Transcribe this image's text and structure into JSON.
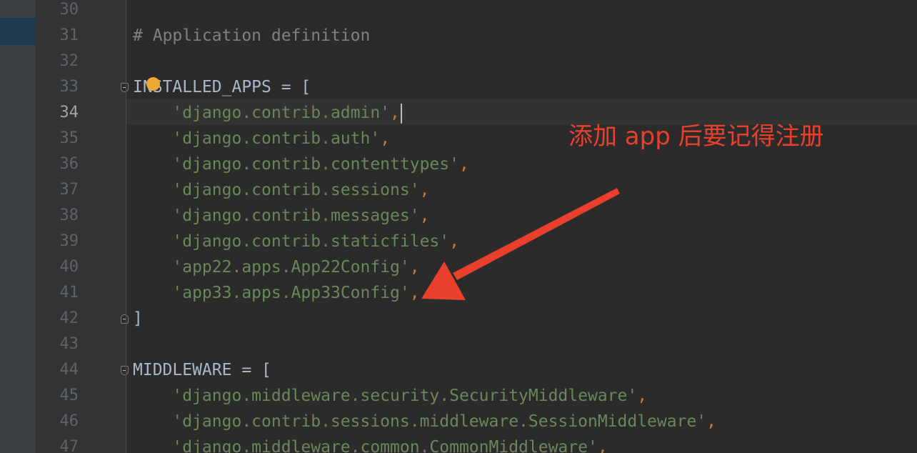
{
  "editor": {
    "lines": [
      {
        "num": "30",
        "tokens": []
      },
      {
        "num": "31",
        "tokens": [
          {
            "t": "# Application definition",
            "c": "comment"
          }
        ]
      },
      {
        "num": "32",
        "tokens": []
      },
      {
        "num": "33",
        "fold": "start",
        "tokens": [
          {
            "t": "INSTALLED_APPS = [",
            "c": "ident"
          }
        ]
      },
      {
        "num": "34",
        "active": true,
        "caret": true,
        "tokens": [
          {
            "t": "    ",
            "c": "ident"
          },
          {
            "t": "'django.contrib.admin'",
            "c": "str"
          },
          {
            "t": ",",
            "c": "punct"
          }
        ]
      },
      {
        "num": "35",
        "tokens": [
          {
            "t": "    ",
            "c": "ident"
          },
          {
            "t": "'django.contrib.auth'",
            "c": "str"
          },
          {
            "t": ",",
            "c": "punct"
          }
        ]
      },
      {
        "num": "36",
        "tokens": [
          {
            "t": "    ",
            "c": "ident"
          },
          {
            "t": "'django.contrib.contenttypes'",
            "c": "str"
          },
          {
            "t": ",",
            "c": "punct"
          }
        ]
      },
      {
        "num": "37",
        "tokens": [
          {
            "t": "    ",
            "c": "ident"
          },
          {
            "t": "'django.contrib.sessions'",
            "c": "str"
          },
          {
            "t": ",",
            "c": "punct"
          }
        ]
      },
      {
        "num": "38",
        "tokens": [
          {
            "t": "    ",
            "c": "ident"
          },
          {
            "t": "'django.contrib.messages'",
            "c": "str"
          },
          {
            "t": ",",
            "c": "punct"
          }
        ]
      },
      {
        "num": "39",
        "tokens": [
          {
            "t": "    ",
            "c": "ident"
          },
          {
            "t": "'django.contrib.staticfiles'",
            "c": "str"
          },
          {
            "t": ",",
            "c": "punct"
          }
        ]
      },
      {
        "num": "40",
        "tokens": [
          {
            "t": "    ",
            "c": "ident"
          },
          {
            "t": "'app22.apps.App22Config'",
            "c": "str"
          },
          {
            "t": ",",
            "c": "punct"
          }
        ]
      },
      {
        "num": "41",
        "tokens": [
          {
            "t": "    ",
            "c": "ident"
          },
          {
            "t": "'app33.apps.App33Config'",
            "c": "str"
          },
          {
            "t": ",",
            "c": "punct"
          }
        ]
      },
      {
        "num": "42",
        "fold": "end",
        "tokens": [
          {
            "t": "]",
            "c": "ident"
          }
        ]
      },
      {
        "num": "43",
        "tokens": []
      },
      {
        "num": "44",
        "fold": "start",
        "tokens": [
          {
            "t": "MIDDLEWARE = [",
            "c": "ident"
          }
        ]
      },
      {
        "num": "45",
        "tokens": [
          {
            "t": "    ",
            "c": "ident"
          },
          {
            "t": "'django.middleware.security.SecurityMiddleware'",
            "c": "str"
          },
          {
            "t": ",",
            "c": "punct"
          }
        ]
      },
      {
        "num": "46",
        "tokens": [
          {
            "t": "    ",
            "c": "ident"
          },
          {
            "t": "'django.contrib.sessions.middleware.SessionMiddleware'",
            "c": "str"
          },
          {
            "t": ",",
            "c": "punct"
          }
        ]
      },
      {
        "num": "47",
        "tokens": [
          {
            "t": "    ",
            "c": "ident"
          },
          {
            "t": "'django.middleware.common.CommonMiddleware'",
            "c": "str"
          },
          {
            "t": ",",
            "c": "punct"
          }
        ]
      }
    ]
  },
  "annotation": {
    "text": "添加 app 后要记得注册",
    "color": "#e8402c"
  },
  "icons": {
    "intention": "lightbulb-icon",
    "fold": "fold-marker-icon"
  }
}
